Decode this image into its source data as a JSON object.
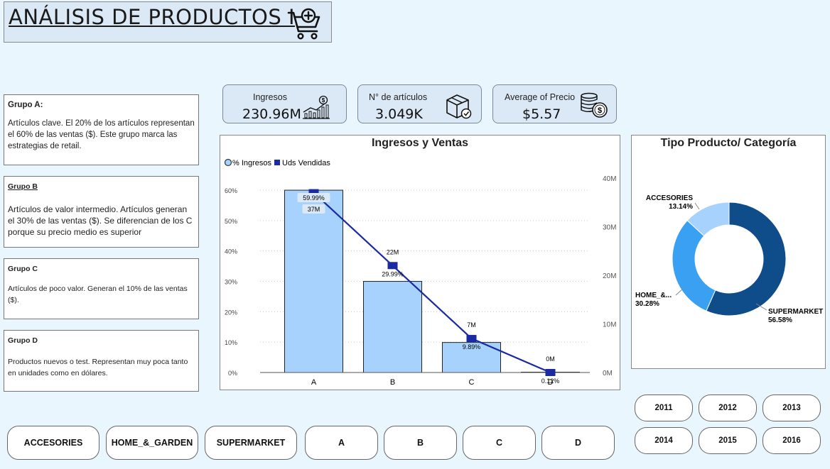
{
  "header": {
    "title": "ANÁLISIS DE PRODUCTOS I",
    "icon": "shopping-cart-add-icon"
  },
  "groups": [
    {
      "title": "Grupo A:",
      "text": "Artículos clave. El 20% de los artículos representan el 60% de las ventas ($). Este grupo marca las estrategias de retail."
    },
    {
      "title": "Grupo B",
      "text": "Artículos de valor intermedio. Artículos generan el 30% de las ventas ($). Se diferencian de los C porque su precio medio es superior"
    },
    {
      "title": "Grupo C",
      "text": "Artículos de poco valor. Generan el 10% de las ventas ($)."
    },
    {
      "title": "Grupo D",
      "text": "Productos nuevos o test. Representan muy poca tanto en unidades como en dólares."
    }
  ],
  "kpis": [
    {
      "label": "Ingresos",
      "value": "230.96M",
      "icon": "revenue-chart-icon"
    },
    {
      "label": "N° de artículos",
      "value": "3.049K",
      "icon": "package-box-icon"
    },
    {
      "label": "Average of Precio",
      "value": "$5.57",
      "icon": "coins-dollar-icon"
    }
  ],
  "colors": {
    "bar": "#a6d2fd",
    "line": "#1a2aa0",
    "donut_dark": "#0e4c8a",
    "donut_mid": "#3aa1f2",
    "donut_light": "#a6d2fd"
  },
  "chart_data": [
    {
      "type": "bar",
      "title": "Ingresos y Ventas",
      "legend": [
        "% Ingresos",
        "Uds Vendidas"
      ],
      "legend_position": "top-left",
      "categories": [
        "A",
        "B",
        "C",
        "D"
      ],
      "series": [
        {
          "name": "% Ingresos",
          "type": "bar",
          "values": [
            59.99,
            29.99,
            9.89,
            0.12
          ],
          "labels": [
            "59.99%",
            "29.99%",
            "9.89%",
            "0.12%"
          ],
          "axis": "left"
        },
        {
          "name": "Uds Vendidas",
          "type": "line",
          "values": [
            37,
            22,
            7,
            0
          ],
          "labels": [
            "37M",
            "22M",
            "7M",
            "0M"
          ],
          "axis": "right"
        }
      ],
      "y_left_ticks": [
        "0%",
        "10%",
        "20%",
        "30%",
        "40%",
        "50%",
        "60%"
      ],
      "y_left_lim": [
        0,
        60
      ],
      "y_right_ticks": [
        "0M",
        "10M",
        "20M",
        "30M",
        "40M"
      ],
      "y_right_lim": [
        0,
        40
      ],
      "grid": true
    },
    {
      "type": "pie",
      "title": "Tipo Producto/ Categoría",
      "slices": [
        {
          "label": "SUPERMARKET",
          "value": 56.58,
          "display": "56.58%"
        },
        {
          "label": "HOME_&...",
          "value": 30.28,
          "display": "30.28%"
        },
        {
          "label": "ACCESORIES",
          "value": 13.14,
          "display": "13.14%"
        }
      ]
    }
  ],
  "filters": {
    "categories": [
      "ACCESORIES",
      "HOME_&_GARDEN",
      "SUPERMARKET",
      "A",
      "B",
      "C",
      "D"
    ],
    "years": [
      "2011",
      "2012",
      "2013",
      "2014",
      "2015",
      "2016"
    ]
  }
}
